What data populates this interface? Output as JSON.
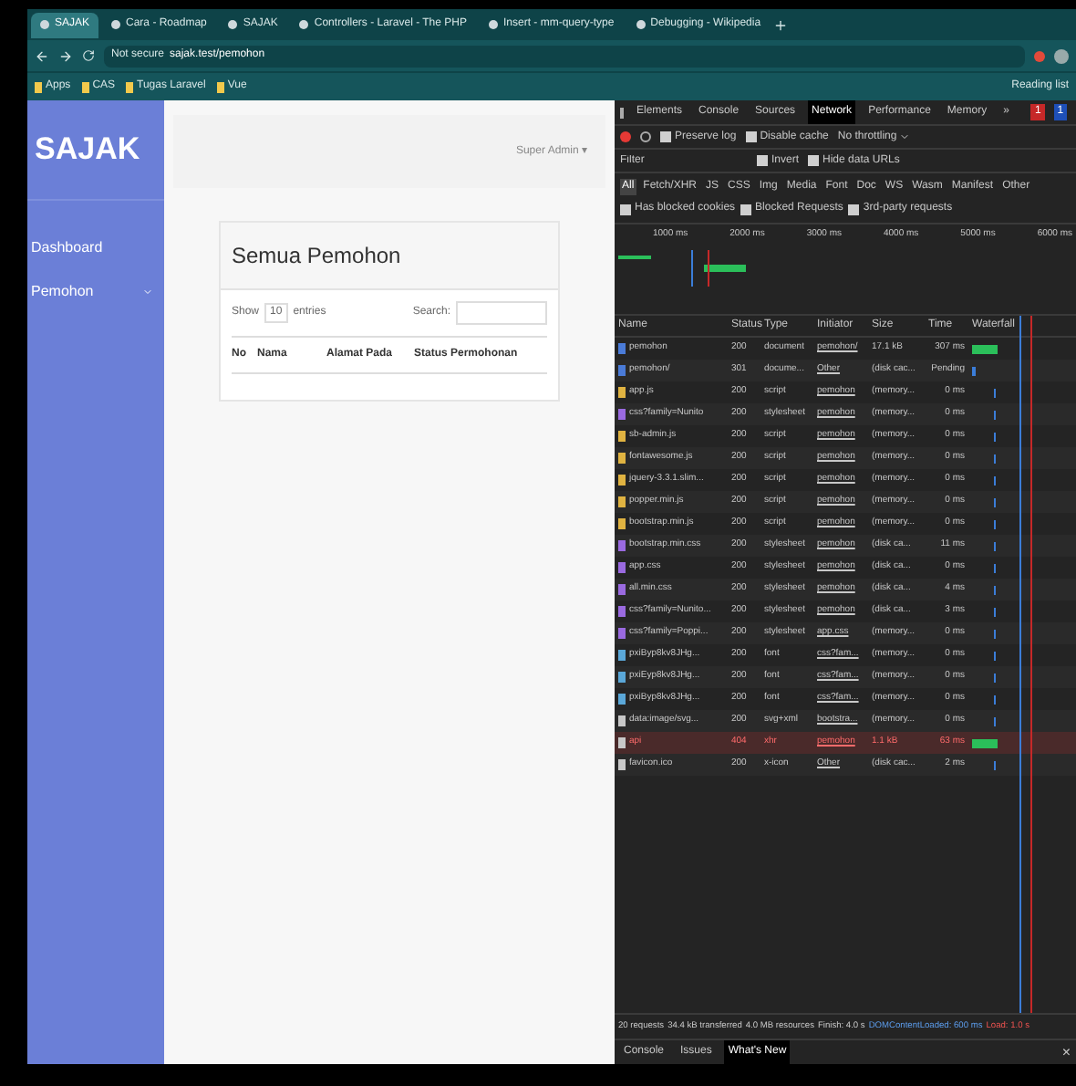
{
  "browser": {
    "tabs": [
      {
        "title": "SAJAK",
        "selected": true
      },
      {
        "title": "Cara - Roadmap",
        "selected": false
      },
      {
        "title": "SAJAK",
        "selected": false
      },
      {
        "title": "Controllers - Laravel - The PHP",
        "selected": false
      },
      {
        "title": "Insert - mm-query-type",
        "selected": false
      },
      {
        "title": "Debugging - Wikipedia",
        "selected": false
      }
    ],
    "address": {
      "security": "Not secure",
      "url": "sajak.test/pemohon"
    },
    "bookmarks": [
      "Apps",
      "CAS",
      "Tugas Laravel",
      "Vue"
    ],
    "reading_list": "Reading list"
  },
  "app": {
    "brand": "SAJAK",
    "user": "Super Admin ▾",
    "sidebar": [
      {
        "label": "Dashboard",
        "caret": false
      },
      {
        "label": "Pemohon",
        "caret": true
      }
    ],
    "card": {
      "title": "Semua Pemohon",
      "show_label": "Show",
      "show_value": "10",
      "entries_label": "entries",
      "search_label": "Search:",
      "columns": [
        "No",
        "Nama",
        "Alamat Pada",
        "Status Permohonan"
      ]
    }
  },
  "devtools": {
    "tabs": [
      {
        "label": "Elements",
        "selected": false
      },
      {
        "label": "Console",
        "selected": false
      },
      {
        "label": "Sources",
        "selected": false
      },
      {
        "label": "Network",
        "selected": true
      },
      {
        "label": "Performance",
        "selected": false
      },
      {
        "label": "Memory",
        "selected": false
      },
      {
        "label": "»",
        "selected": false
      }
    ],
    "errors": "1",
    "warnings": "1",
    "toolbar": [
      {
        "label": "Preserve log",
        "checked": false
      },
      {
        "label": "Disable cache",
        "checked": false
      }
    ],
    "throttling": "No throttling",
    "filter_placeholder": "Filter",
    "filter_options": [
      {
        "label": "Invert",
        "checked": false
      },
      {
        "label": "Hide data URLs",
        "checked": false
      }
    ],
    "types": [
      {
        "label": "All",
        "selected": true
      },
      {
        "label": "Fetch/XHR",
        "selected": false
      },
      {
        "label": "JS",
        "selected": false
      },
      {
        "label": "CSS",
        "selected": false
      },
      {
        "label": "Img",
        "selected": false
      },
      {
        "label": "Media",
        "selected": false
      },
      {
        "label": "Font",
        "selected": false
      },
      {
        "label": "Doc",
        "selected": false
      },
      {
        "label": "WS",
        "selected": false
      },
      {
        "label": "Wasm",
        "selected": false
      },
      {
        "label": "Manifest",
        "selected": false
      },
      {
        "label": "Other",
        "selected": false
      }
    ],
    "blocked": [
      {
        "label": "Has blocked cookies",
        "checked": false
      },
      {
        "label": "Blocked Requests",
        "checked": false
      },
      {
        "label": "3rd-party requests",
        "checked": false
      }
    ],
    "ticks": [
      "1000 ms",
      "2000 ms",
      "3000 ms",
      "4000 ms",
      "5000 ms",
      "6000 ms"
    ],
    "columns": [
      "Name",
      "Status",
      "Type",
      "Initiator",
      "Size",
      "Time",
      "Waterfall"
    ],
    "rows": [
      {
        "kind": "doc",
        "name": "pemohon",
        "status": "200",
        "type": "document",
        "initiator": "pemohon/",
        "size": "17.1 kB",
        "time": "307 ms",
        "failed": false
      },
      {
        "kind": "doc",
        "name": "pemohon/",
        "status": "301",
        "type": "docume...",
        "initiator": "Other",
        "size": "(disk cac...",
        "time": "Pending",
        "failed": false
      },
      {
        "kind": "script",
        "name": "app.js",
        "status": "200",
        "type": "script",
        "initiator": "pemohon",
        "size": "(memory...",
        "time": "0 ms",
        "failed": false
      },
      {
        "kind": "style",
        "name": "css?family=Nunito",
        "status": "200",
        "type": "stylesheet",
        "initiator": "pemohon",
        "size": "(memory...",
        "time": "0 ms",
        "failed": false
      },
      {
        "kind": "script",
        "name": "sb-admin.js",
        "status": "200",
        "type": "script",
        "initiator": "pemohon",
        "size": "(memory...",
        "time": "0 ms",
        "failed": false
      },
      {
        "kind": "script",
        "name": "fontawesome.js",
        "status": "200",
        "type": "script",
        "initiator": "pemohon",
        "size": "(memory...",
        "time": "0 ms",
        "failed": false
      },
      {
        "kind": "script",
        "name": "jquery-3.3.1.slim...",
        "status": "200",
        "type": "script",
        "initiator": "pemohon",
        "size": "(memory...",
        "time": "0 ms",
        "failed": false
      },
      {
        "kind": "script",
        "name": "popper.min.js",
        "status": "200",
        "type": "script",
        "initiator": "pemohon",
        "size": "(memory...",
        "time": "0 ms",
        "failed": false
      },
      {
        "kind": "script",
        "name": "bootstrap.min.js",
        "status": "200",
        "type": "script",
        "initiator": "pemohon",
        "size": "(memory...",
        "time": "0 ms",
        "failed": false
      },
      {
        "kind": "style",
        "name": "bootstrap.min.css",
        "status": "200",
        "type": "stylesheet",
        "initiator": "pemohon",
        "size": "(disk ca...",
        "time": "11 ms",
        "failed": false
      },
      {
        "kind": "style",
        "name": "app.css",
        "status": "200",
        "type": "stylesheet",
        "initiator": "pemohon",
        "size": "(disk ca...",
        "time": "0 ms",
        "failed": false
      },
      {
        "kind": "style",
        "name": "all.min.css",
        "status": "200",
        "type": "stylesheet",
        "initiator": "pemohon",
        "size": "(disk ca...",
        "time": "4 ms",
        "failed": false
      },
      {
        "kind": "style",
        "name": "css?family=Nunito...",
        "status": "200",
        "type": "stylesheet",
        "initiator": "pemohon",
        "size": "(disk ca...",
        "time": "3 ms",
        "failed": false
      },
      {
        "kind": "style",
        "name": "css?family=Poppi...",
        "status": "200",
        "type": "stylesheet",
        "initiator": "app.css",
        "size": "(memory...",
        "time": "0 ms",
        "failed": false
      },
      {
        "kind": "font",
        "name": "pxiByp8kv8JHg...",
        "status": "200",
        "type": "font",
        "initiator": "css?fam...",
        "size": "(memory...",
        "time": "0 ms",
        "failed": false
      },
      {
        "kind": "font",
        "name": "pxiEyp8kv8JHg...",
        "status": "200",
        "type": "font",
        "initiator": "css?fam...",
        "size": "(memory...",
        "time": "0 ms",
        "failed": false
      },
      {
        "kind": "font",
        "name": "pxiByp8kv8JHg...",
        "status": "200",
        "type": "font",
        "initiator": "css?fam...",
        "size": "(memory...",
        "time": "0 ms",
        "failed": false
      },
      {
        "kind": "other",
        "name": "data:image/svg...",
        "status": "200",
        "type": "svg+xml",
        "initiator": "bootstra...",
        "size": "(memory...",
        "time": "0 ms",
        "failed": false
      },
      {
        "kind": "other",
        "name": "api",
        "status": "404",
        "type": "xhr",
        "initiator": "pemohon",
        "size": "1.1 kB",
        "time": "63 ms",
        "failed": true
      },
      {
        "kind": "other",
        "name": "favicon.ico",
        "status": "200",
        "type": "x-icon",
        "initiator": "Other",
        "size": "(disk cac...",
        "time": "2 ms",
        "failed": false
      }
    ],
    "summary": [
      {
        "text": "20 requests",
        "kind": "plain"
      },
      {
        "text": "34.4 kB transferred",
        "kind": "plain"
      },
      {
        "text": "4.0 MB resources",
        "kind": "plain"
      },
      {
        "text": "Finish: 4.0 s",
        "kind": "plain"
      },
      {
        "text": "DOMContentLoaded: 600 ms",
        "kind": "dom"
      },
      {
        "text": "Load: 1.0 s",
        "kind": "load"
      }
    ],
    "drawer": [
      {
        "label": "Console",
        "selected": false
      },
      {
        "label": "Issues",
        "selected": false
      },
      {
        "label": "What's New",
        "selected": true
      }
    ],
    "drawer_close": "×"
  }
}
